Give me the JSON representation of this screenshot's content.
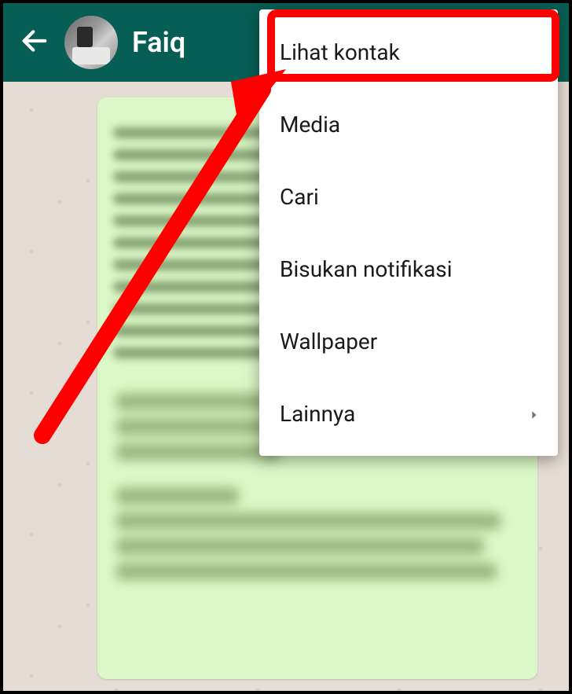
{
  "header": {
    "contact_name": "Faiq"
  },
  "menu": {
    "items": [
      {
        "label": "Lihat kontak"
      },
      {
        "label": "Media"
      },
      {
        "label": "Cari"
      },
      {
        "label": "Bisukan notifikasi"
      },
      {
        "label": "Wallpaper"
      },
      {
        "label": "Lainnya",
        "has_submenu": true
      }
    ]
  },
  "annotation": {
    "highlight_color": "#ff0000",
    "arrow_color": "#ff0000"
  }
}
